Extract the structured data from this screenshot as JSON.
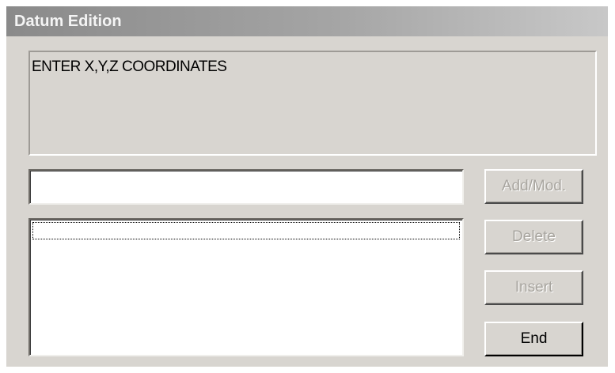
{
  "window": {
    "title": "Datum Edition"
  },
  "message": {
    "text": "ENTER X,Y,Z COORDINATES"
  },
  "entry": {
    "value": "",
    "placeholder": ""
  },
  "list": {
    "items": []
  },
  "buttons": {
    "add_mod": {
      "label": "Add/Mod.",
      "enabled": false
    },
    "delete": {
      "label": "Delete",
      "enabled": false
    },
    "insert": {
      "label": "Insert",
      "enabled": false
    },
    "end": {
      "label": "End",
      "enabled": true
    }
  },
  "colors": {
    "dialog_background": "#d8d5d0",
    "titlebar_start": "#8a8a8a",
    "titlebar_end": "#c8c8c8",
    "disabled_text": "#a8a59f"
  }
}
